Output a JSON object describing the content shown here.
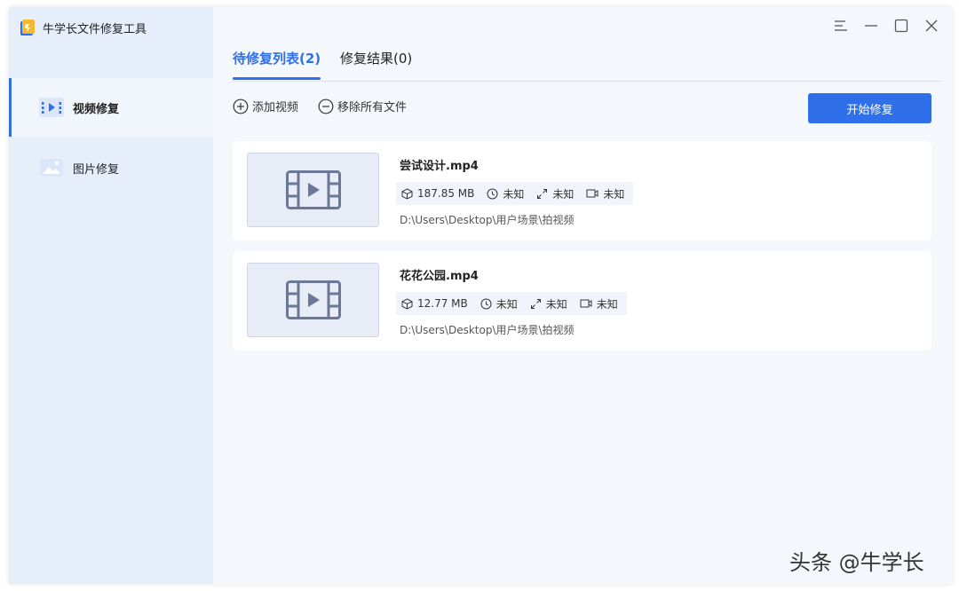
{
  "app": {
    "title": "牛学长文件修复工具"
  },
  "sidebar": {
    "items": [
      {
        "label": "视频修复",
        "icon": "video-repair-icon",
        "active": true
      },
      {
        "label": "图片修复",
        "icon": "image-repair-icon",
        "active": false
      }
    ]
  },
  "window_controls": [
    "menu-icon",
    "minimize-icon",
    "maximize-icon",
    "close-icon"
  ],
  "tabs": [
    {
      "label": "待修复列表(2)",
      "active": true
    },
    {
      "label": "修复结果(0)",
      "active": false
    }
  ],
  "toolbar": {
    "add_label": "添加视频",
    "remove_label": "移除所有文件",
    "start_label": "开始修复"
  },
  "files": [
    {
      "name": "尝试设计.mp4",
      "size": "187.85 MB",
      "duration": "未知",
      "resolution": "未知",
      "camera": "未知",
      "path": "D:\\Users\\Desktop\\用户场景\\拍视频"
    },
    {
      "name": "花花公园.mp4",
      "size": "12.77 MB",
      "duration": "未知",
      "resolution": "未知",
      "camera": "未知",
      "path": "D:\\Users\\Desktop\\用户场景\\拍视频"
    }
  ],
  "watermark": "头条 @牛学长",
  "colors": {
    "accent": "#2f6fea",
    "sidebar": "#e6eef9",
    "content": "#f4f7fc"
  }
}
